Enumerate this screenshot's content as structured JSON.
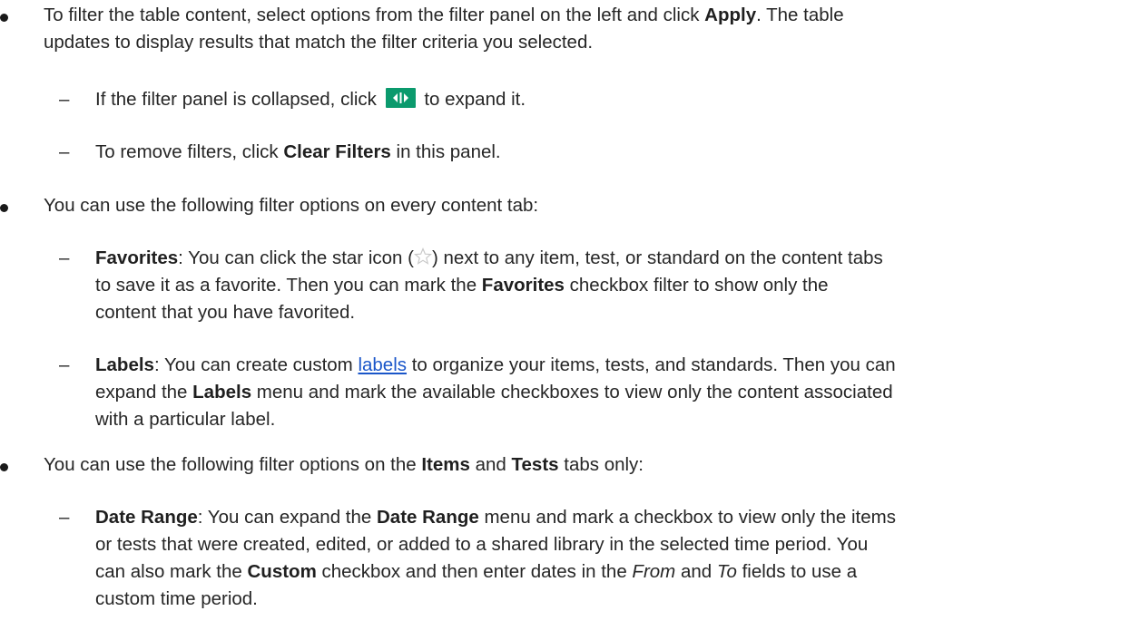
{
  "b1": {
    "t1": "To filter the table content, select options from the filter panel on the left and click ",
    "apply": "Apply",
    "t2": ". The table",
    "line2": "updates to display results that match the filter criteria you selected."
  },
  "sub1": {
    "t1": "If the filter panel is collapsed, click ",
    "icon": "expand-panel-icon",
    "t2": " to expand it."
  },
  "sub2": {
    "t1": "To remove filters, click ",
    "bold": "Clear Filters",
    "t2": " in this panel."
  },
  "b2": {
    "text": "You can use the following filter options on every content tab:"
  },
  "fav": {
    "bold": "Favorites",
    "t1": ": You can click the star icon (",
    "icon": "star-icon",
    "t2": ") next to any item, test, or standard on the content tabs",
    "line2_a": "to save it as a favorite. Then you can mark the ",
    "line2_bold": "Favorites",
    "line2_b": " checkbox filter to show only the",
    "line3": "content that you have favorited."
  },
  "labels": {
    "bold": "Labels",
    "t1": ": You can create custom ",
    "link": "labels",
    "t2": " to organize your items, tests, and standards. Then you can",
    "line2_a": "expand the ",
    "line2_bold": "Labels",
    "line2_b": " menu and mark the available checkboxes to view only the content associated",
    "line3": "with a particular label."
  },
  "b3": {
    "t1": "You can use the following filter options on the ",
    "items": "Items",
    "and": " and ",
    "tests": "Tests",
    "t2": " tabs only:"
  },
  "date": {
    "bold": "Date Range",
    "t1": ": You can expand the ",
    "bold2": "Date Range",
    "t2": " menu and mark a checkbox to view only the items",
    "line2": "or tests that were created, edited, or added to a shared library in the selected time period. You",
    "line3_a": "can also mark the ",
    "line3_bold": "Custom",
    "line3_b": " checkbox and then enter dates in the ",
    "from": "From",
    "line3_c": " and ",
    "to": "To",
    "line3_d": " fields to use a",
    "line4": "custom time period."
  },
  "colors": {
    "icon_green": "#0b9a6d",
    "link_blue": "#1a56c9"
  }
}
